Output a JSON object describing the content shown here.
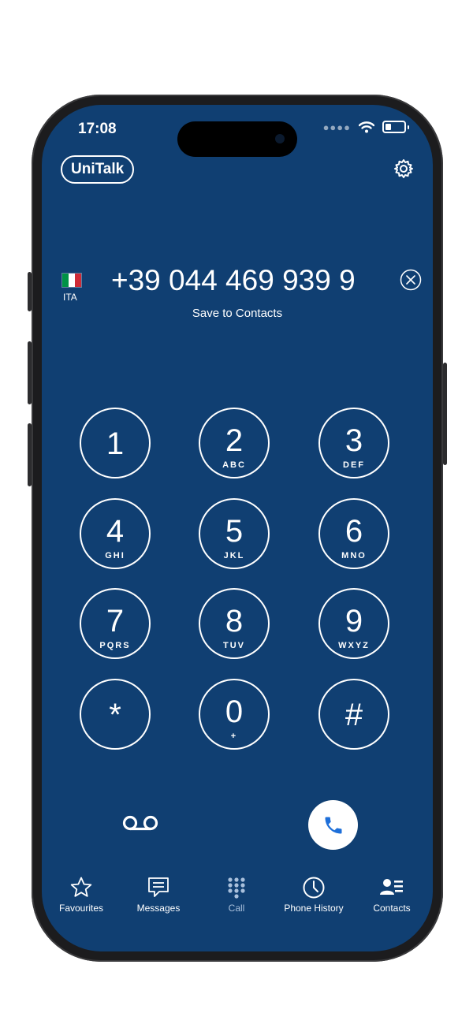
{
  "status_bar": {
    "time": "17:08"
  },
  "header": {
    "brand_label": "UniTalk",
    "settings_icon": "gear-icon"
  },
  "dial": {
    "country_code": "ITA",
    "flag_colors": [
      "#009246",
      "#ffffff",
      "#ce2b37"
    ],
    "number": "+39 044 469 939 9",
    "save_label": "Save to Contacts"
  },
  "keypad": [
    {
      "digit": "1",
      "letters": ""
    },
    {
      "digit": "2",
      "letters": "ABC"
    },
    {
      "digit": "3",
      "letters": "DEF"
    },
    {
      "digit": "4",
      "letters": "GHI"
    },
    {
      "digit": "5",
      "letters": "JKL"
    },
    {
      "digit": "6",
      "letters": "MNO"
    },
    {
      "digit": "7",
      "letters": "PQRS"
    },
    {
      "digit": "8",
      "letters": "TUV"
    },
    {
      "digit": "9",
      "letters": "WXYZ"
    },
    {
      "digit": "*",
      "letters": ""
    },
    {
      "digit": "0",
      "letters": "+"
    },
    {
      "digit": "#",
      "letters": ""
    }
  ],
  "tabs": [
    {
      "label": "Favourites",
      "icon": "star-icon"
    },
    {
      "label": "Messages",
      "icon": "message-icon"
    },
    {
      "label": "Call",
      "icon": "keypad-icon"
    },
    {
      "label": "Phone History",
      "icon": "clock-icon"
    },
    {
      "label": "Contacts",
      "icon": "contacts-icon"
    }
  ],
  "colors": {
    "background": "#103f72",
    "call_icon": "#1e6fd9",
    "active_tab": "#a9c0dc"
  }
}
